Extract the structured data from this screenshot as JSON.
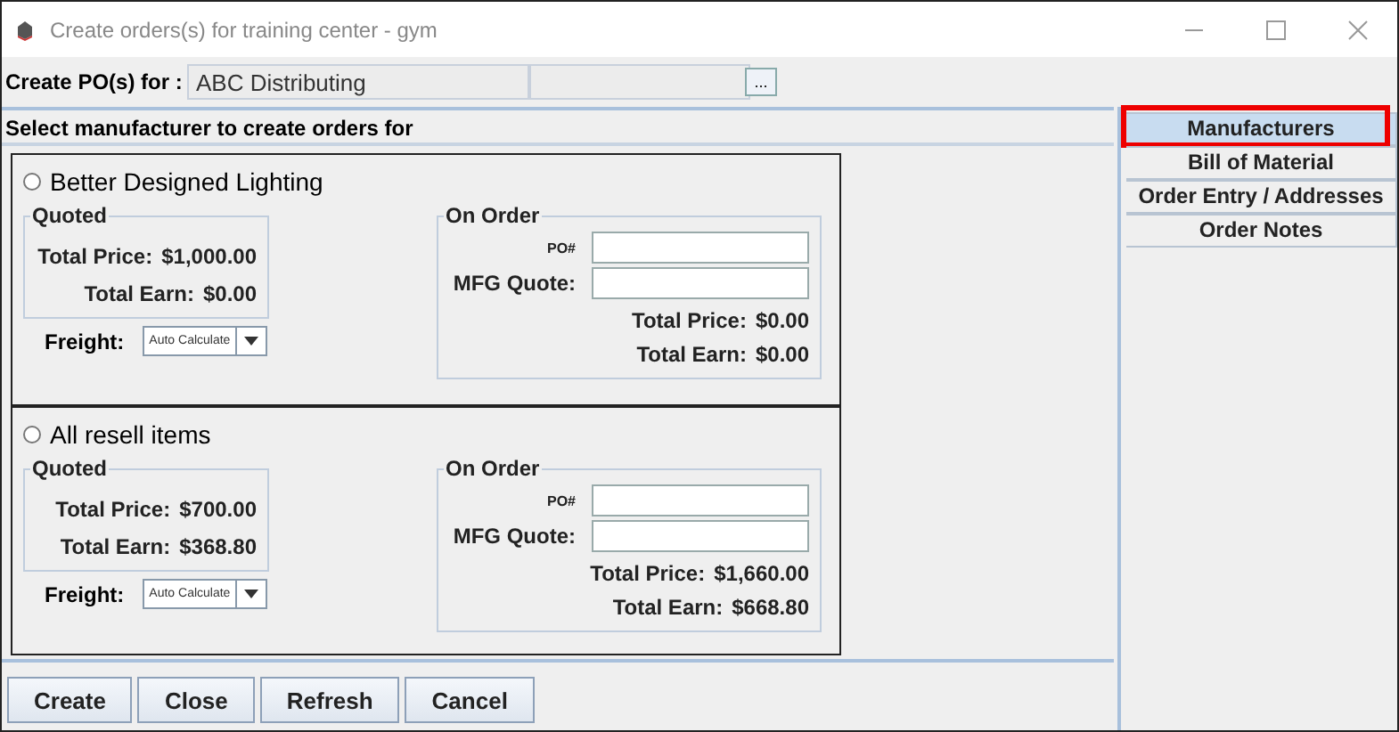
{
  "window": {
    "title": "Create orders(s) for training center - gym"
  },
  "po_for": {
    "label": "Create PO(s) for :",
    "value": "ABC Distributing",
    "browse": "..."
  },
  "section_title": "Select manufacturer to create orders for",
  "manufacturers": [
    {
      "name": "Better Designed Lighting",
      "selected": false,
      "quoted": {
        "title": "Quoted",
        "price_label": "Total Price:",
        "price": "$1,000.00",
        "earn_label": "Total Earn:",
        "earn": "$0.00"
      },
      "freight": {
        "label": "Freight:",
        "value": "Auto Calculate"
      },
      "on_order": {
        "title": "On Order",
        "po_label": "PO#",
        "quote_label": "MFG Quote:",
        "price_label": "Total Price:",
        "price": "$0.00",
        "earn_label": "Total Earn:",
        "earn": "$0.00"
      }
    },
    {
      "name": "All resell items",
      "selected": false,
      "quoted": {
        "title": "Quoted",
        "price_label": "Total Price:",
        "price": "$700.00",
        "earn_label": "Total Earn:",
        "earn": "$368.80"
      },
      "freight": {
        "label": "Freight:",
        "value": "Auto Calculate"
      },
      "on_order": {
        "title": "On Order",
        "po_label": "PO#",
        "quote_label": "MFG Quote:",
        "price_label": "Total Price:",
        "price": "$1,660.00",
        "earn_label": "Total Earn:",
        "earn": "$668.80"
      }
    }
  ],
  "tabs": [
    {
      "label": "Manufacturers",
      "selected": true,
      "highlighted": true
    },
    {
      "label": "Bill of Material",
      "selected": false,
      "highlighted": false
    },
    {
      "label": "Order Entry / Addresses",
      "selected": false,
      "highlighted": false
    },
    {
      "label": "Order Notes",
      "selected": false,
      "highlighted": false
    }
  ],
  "buttons": [
    "Create",
    "Close",
    "Refresh",
    "Cancel"
  ]
}
